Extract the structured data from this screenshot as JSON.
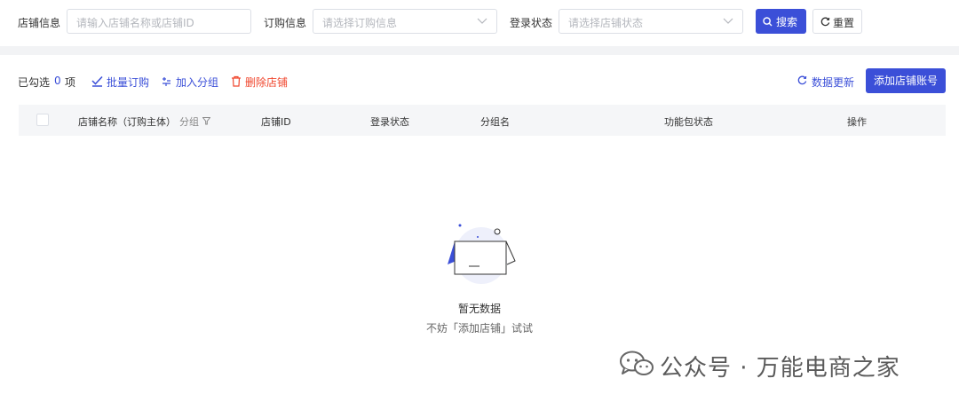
{
  "filters": {
    "store_info": {
      "label": "店铺信息",
      "placeholder": "请输入店铺名称或店铺ID"
    },
    "order_info": {
      "label": "订购信息",
      "placeholder": "请选择订购信息"
    },
    "login_status": {
      "label": "登录状态",
      "placeholder": "请选择店铺状态"
    },
    "search_label": "搜索",
    "reset_label": "重置"
  },
  "toolbar": {
    "selected_prefix": "已勾选",
    "selected_count": "0",
    "selected_suffix": "项",
    "batch_order": "批量订购",
    "add_group": "加入分组",
    "delete_store": "删除店铺",
    "refresh_data": "数据更新",
    "add_account": "添加店铺账号"
  },
  "table": {
    "columns": [
      "店铺名称（订购主体）",
      "分组",
      "店铺ID",
      "登录状态",
      "分组名",
      "功能包状态",
      "操作"
    ]
  },
  "empty": {
    "title": "暂无数据",
    "subtitle": "不妨「添加店铺」试试"
  },
  "watermark": {
    "text": "公众号 · 万能电商之家"
  },
  "colors": {
    "primary": "#3b4fd8",
    "danger": "#f0462d",
    "header_bg": "#f5f6f8",
    "page_bg": "#f2f3f5"
  }
}
